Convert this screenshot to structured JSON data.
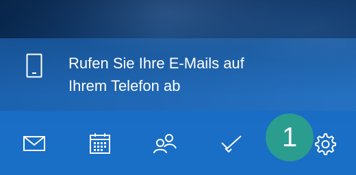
{
  "promo": {
    "line1": "Rufen Sie Ihre E-Mails auf",
    "line2": "Ihrem Telefon ab",
    "icon": "mobile-phone-icon"
  },
  "nav": {
    "items": [
      {
        "name": "mail",
        "icon": "mail-icon"
      },
      {
        "name": "calendar",
        "icon": "calendar-icon"
      },
      {
        "name": "people",
        "icon": "people-icon"
      },
      {
        "name": "todo",
        "icon": "checkmark-icon"
      },
      {
        "name": "settings",
        "icon": "gear-icon"
      }
    ]
  },
  "annotation": {
    "badge_number": "1",
    "badge_color": "#2a9d8f"
  },
  "colors": {
    "navbar": "#1a70c8",
    "icon": "#ffffff"
  }
}
